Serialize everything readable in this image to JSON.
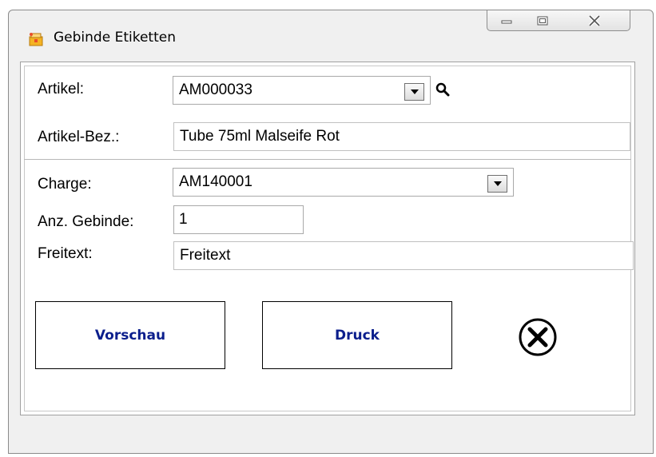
{
  "window": {
    "title": "Gebinde Etiketten",
    "controls": [
      "minimize",
      "maximize",
      "close"
    ]
  },
  "form": {
    "artikel": {
      "label": "Artikel:",
      "value": "AM000033"
    },
    "artikel_bez": {
      "label": "Artikel-Bez.:",
      "value": "Tube 75ml  Malseife Rot"
    },
    "charge": {
      "label": "Charge:",
      "value": "AM140001"
    },
    "anz_gebinde": {
      "label": "Anz. Gebinde:",
      "value": "1"
    },
    "freitext": {
      "label": "Freitext:",
      "value": "Freitext"
    }
  },
  "buttons": {
    "preview": "Vorschau",
    "print": "Druck"
  },
  "icons": {
    "app": "app-icon",
    "search": "search-icon",
    "close_form": "close-circle-icon"
  },
  "colors": {
    "button_text": "#0b1e8c"
  }
}
